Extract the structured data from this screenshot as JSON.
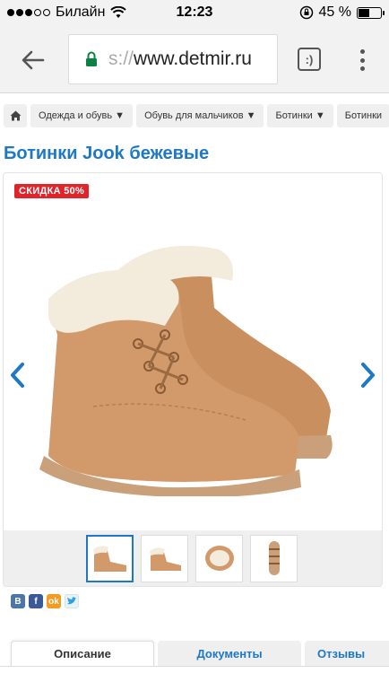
{
  "status_bar": {
    "carrier": "Билайн",
    "time": "12:23",
    "battery": "45 %",
    "battery_level": 0.45,
    "signal_filled": 3,
    "signal_total": 5
  },
  "browser": {
    "url_prefix": "s://",
    "url_host": "www.detmir.ru",
    "tabs_count": ":)"
  },
  "breadcrumbs": [
    "Одежда и обувь ▼",
    "Обувь для мальчиков ▼",
    "Ботинки ▼",
    "Ботинки"
  ],
  "product": {
    "title": "Ботинки Jook бежевые",
    "discount": "СКИДКА  50%"
  },
  "social": {
    "vk": "В",
    "fb": "f",
    "ok": "ok",
    "tw": ""
  },
  "tabs": {
    "description": "Описание",
    "documents": "Документы",
    "reviews": "Отзывы"
  },
  "colors": {
    "accent": "#1e78c8",
    "discount": "#e1232a",
    "boot": "#d29a6b",
    "fur": "#f3ebdc",
    "sole": "#c9a07a"
  }
}
